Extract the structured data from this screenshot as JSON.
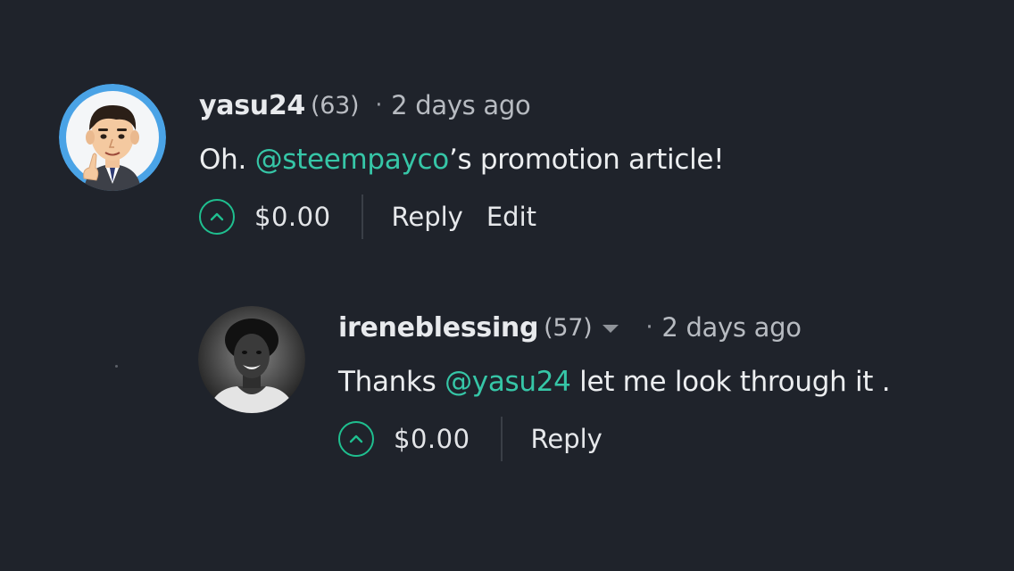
{
  "colors": {
    "background": "#1f232b",
    "accent": "#1fbf8f",
    "mention": "#36c6a7"
  },
  "comments": [
    {
      "author": "yasu24",
      "reputation": "(63)",
      "separator": "·",
      "time": "2 days ago",
      "text_before": "Oh. ",
      "mention": "@steempayco",
      "text_after": "’s promotion article!",
      "payout": "$0.00",
      "actions": [
        "Reply",
        "Edit"
      ],
      "avatar_icon": "cartoon-man-avatar"
    },
    {
      "author": "ireneblessing",
      "reputation": "(57)",
      "separator": "·",
      "time": "2 days ago",
      "text_before": "Thanks ",
      "mention": "@yasu24",
      "text_after": " let me look through it .",
      "payout": "$0.00",
      "actions": [
        "Reply"
      ],
      "avatar_icon": "woman-photo-avatar"
    }
  ]
}
